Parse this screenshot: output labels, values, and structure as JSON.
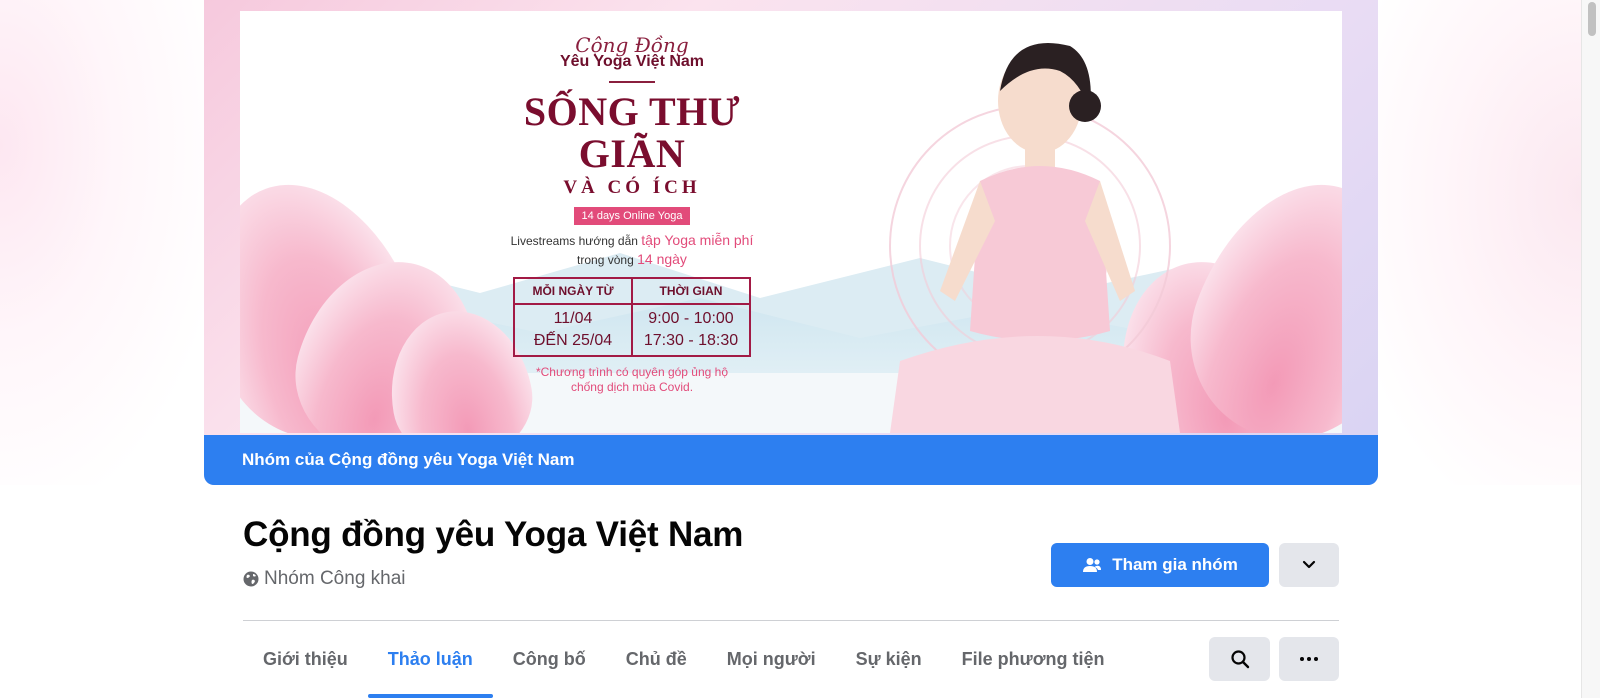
{
  "cover": {
    "poster": {
      "script_title": "Cộng Đồng",
      "subtitle": "Yêu Yoga Việt Nam",
      "headline": "SỐNG THƯ GIÃN",
      "headline2": "VÀ CÓ ÍCH",
      "badge": "14 days Online Yoga",
      "line1_prefix": "Livestreams hướng dẫn",
      "line1_highlight": "tập Yoga miễn phí",
      "line2_prefix": "trong vòng",
      "line2_highlight": "14 ngày",
      "table": {
        "headers": [
          "MỖI NGÀY TỪ",
          "THỜI GIAN"
        ],
        "col1": [
          "11/04",
          "ĐẾN 25/04"
        ],
        "col2": [
          "9:00 - 10:00",
          "17:30 - 18:30"
        ]
      },
      "note_line1": "*Chương trình có quyên góp ủng hộ",
      "note_line2": "chống dịch mùa Covid."
    },
    "banner_text": "Nhóm của Cộng đồng yêu Yoga Việt Nam"
  },
  "group": {
    "title": "Cộng đồng yêu Yoga Việt Nam",
    "type": "Nhóm Công khai",
    "type_icon": "globe-icon"
  },
  "actions": {
    "join_label": "Tham gia nhóm",
    "join_icon": "group-add-icon",
    "accent": "#2d7ff0"
  },
  "tabs": [
    {
      "label": "Giới thiệu",
      "active": false
    },
    {
      "label": "Thảo luận",
      "active": true
    },
    {
      "label": "Công bố",
      "active": false
    },
    {
      "label": "Chủ đề",
      "active": false
    },
    {
      "label": "Mọi người",
      "active": false
    },
    {
      "label": "Sự kiện",
      "active": false
    },
    {
      "label": "File phương tiện",
      "active": false
    }
  ]
}
